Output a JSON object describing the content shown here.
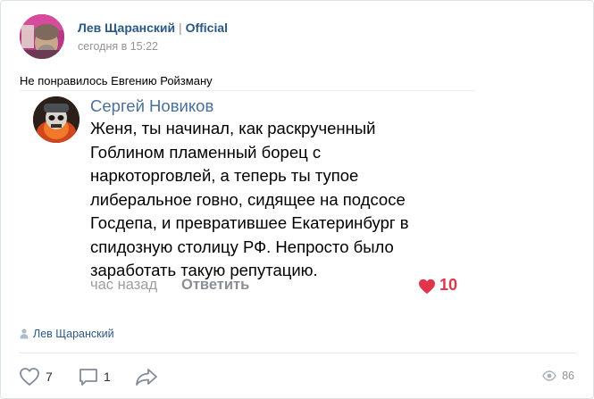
{
  "post": {
    "author": "Лев Щаранский",
    "separator": "|",
    "author_suffix": "Official",
    "date": "сегодня в 15:22",
    "text": "Не понравилось Евгению Ройзману"
  },
  "screenshot_comment": {
    "name": "Сергей Новиков",
    "lines": [
      "Женя, ты начинал, как раскрученный",
      "Гоблином пламенный борец с",
      "наркоторговлей, а теперь ты тупое",
      "либеральное говно, сидящее на подсосе",
      "Госдепа, и превратившее Екатеринбург в",
      "спидозную столицу РФ. Непросто было",
      "заработать такую репутацию."
    ],
    "time": "час назад",
    "reply_label": "Ответить",
    "likes": "10",
    "like_color": "#e0354c"
  },
  "signer": {
    "name": "Лев Щаранский",
    "icon": "person-icon"
  },
  "actions": {
    "likes": "7",
    "comments": "1",
    "views": "86",
    "like_icon": "heart-outline-icon",
    "comment_icon": "comment-icon",
    "share_icon": "share-icon",
    "views_icon": "eye-icon"
  },
  "colors": {
    "link": "#2a5885",
    "muted": "#939393",
    "divider": "#e7e8ec"
  }
}
